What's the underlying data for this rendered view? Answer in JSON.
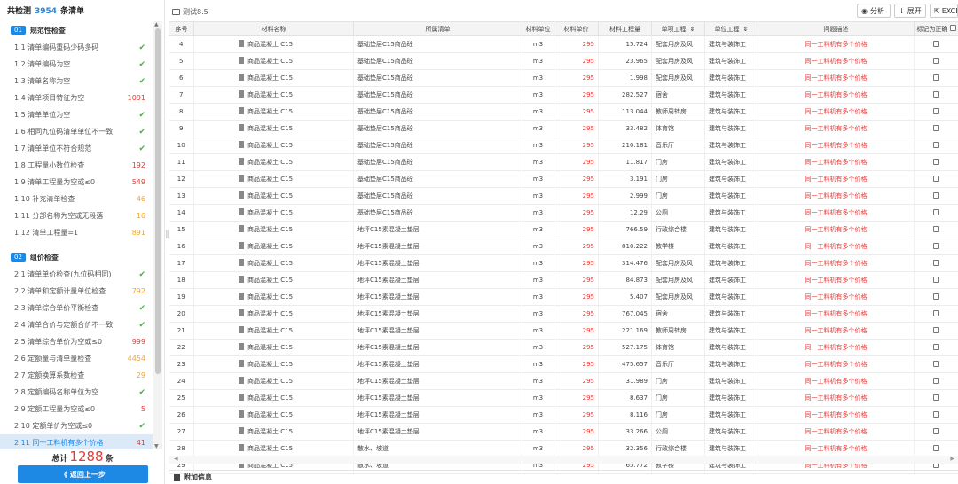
{
  "left": {
    "header_prefix": "共检测",
    "header_count": "3954",
    "header_suffix": "条清单",
    "groups": [
      {
        "badge": "01",
        "title": "规范性检查",
        "items": [
          {
            "label": "1.1 清单编码重码少码多码",
            "value": "✔",
            "kind": "green"
          },
          {
            "label": "1.2 清单编码为空",
            "value": "✔",
            "kind": "green"
          },
          {
            "label": "1.3 清单名称为空",
            "value": "✔",
            "kind": "green"
          },
          {
            "label": "1.4 清单项目特征为空",
            "value": "1091",
            "kind": "red"
          },
          {
            "label": "1.5 清单单位为空",
            "value": "✔",
            "kind": "green"
          },
          {
            "label": "1.6 相同九位码清单单位不一致",
            "value": "✔",
            "kind": "green"
          },
          {
            "label": "1.7 清单单位不符合规范",
            "value": "✔",
            "kind": "green"
          },
          {
            "label": "1.8 工程量小数位检查",
            "value": "192",
            "kind": "red"
          },
          {
            "label": "1.9 清单工程量为空或≤0",
            "value": "549",
            "kind": "red"
          },
          {
            "label": "1.10 补充清单检查",
            "value": "46",
            "kind": "orange"
          },
          {
            "label": "1.11 分部名称为空或无段落",
            "value": "16",
            "kind": "orange"
          },
          {
            "label": "1.12 清单工程量=1",
            "value": "891",
            "kind": "orange"
          }
        ]
      },
      {
        "badge": "02",
        "title": "组价检查",
        "items": [
          {
            "label": "2.1 清单单价检查(九位码相同)",
            "value": "✔",
            "kind": "green"
          },
          {
            "label": "2.2 清单和定额计量单位检查",
            "value": "792",
            "kind": "orange"
          },
          {
            "label": "2.3 清单综合单价平衡检查",
            "value": "✔",
            "kind": "green"
          },
          {
            "label": "2.4 清单合价与定额合价不一致",
            "value": "✔",
            "kind": "green"
          },
          {
            "label": "2.5 清单综合单价为空或≤0",
            "value": "999",
            "kind": "red"
          },
          {
            "label": "2.6 定额量与清单量检查",
            "value": "4454",
            "kind": "orange"
          },
          {
            "label": "2.7 定额换算系数检查",
            "value": "29",
            "kind": "orange"
          },
          {
            "label": "2.8 定额编码名称单位为空",
            "value": "✔",
            "kind": "green"
          },
          {
            "label": "2.9 定额工程量为空或≤0",
            "value": "5",
            "kind": "red"
          },
          {
            "label": "2.10 定额单价为空或≤0",
            "value": "✔",
            "kind": "green"
          },
          {
            "label": "2.11 同一工料机有多个价格",
            "value": "41",
            "kind": "red",
            "active": true
          },
          {
            "label": "2.12 工料机用量为空或≤0",
            "value": "5",
            "kind": "red"
          }
        ]
      }
    ],
    "total_label": "总计",
    "total_value": "1288",
    "total_unit": "条",
    "back_label": "《 返回上一步"
  },
  "right": {
    "breadcrumb": "测试8.5",
    "buttons": {
      "analyze": "分析",
      "expand": "展开",
      "export": "EXCE"
    },
    "columns": [
      "序号",
      "材料名称",
      "所属清单",
      "材料单位",
      "材料单价",
      "材料工程量",
      "单项工程",
      "单位工程",
      "问题描述",
      "标记为正确"
    ],
    "rows": [
      [
        "4",
        "商品混凝土 C15",
        "基础垫层C15商品砼",
        "m3",
        "295",
        "15.724",
        "配套用房及风",
        "建筑与装饰工",
        "同一工料机有多个价格"
      ],
      [
        "5",
        "商品混凝土 C15",
        "基础垫层C15商品砼",
        "m3",
        "295",
        "23.965",
        "配套用房及风",
        "建筑与装饰工",
        "同一工料机有多个价格"
      ],
      [
        "6",
        "商品混凝土 C15",
        "基础垫层C15商品砼",
        "m3",
        "295",
        "1.998",
        "配套用房及风",
        "建筑与装饰工",
        "同一工料机有多个价格"
      ],
      [
        "7",
        "商品混凝土 C15",
        "基础垫层C15商品砼",
        "m3",
        "295",
        "282.527",
        "宿舍",
        "建筑与装饰工",
        "同一工料机有多个价格"
      ],
      [
        "8",
        "商品混凝土 C15",
        "基础垫层C15商品砼",
        "m3",
        "295",
        "113.044",
        "教师周转房",
        "建筑与装饰工",
        "同一工料机有多个价格"
      ],
      [
        "9",
        "商品混凝土 C15",
        "基础垫层C15商品砼",
        "m3",
        "295",
        "33.482",
        "体育馆",
        "建筑与装饰工",
        "同一工料机有多个价格"
      ],
      [
        "10",
        "商品混凝土 C15",
        "基础垫层C15商品砼",
        "m3",
        "295",
        "210.181",
        "音乐厅",
        "建筑与装饰工",
        "同一工料机有多个价格"
      ],
      [
        "11",
        "商品混凝土 C15",
        "基础垫层C15商品砼",
        "m3",
        "295",
        "11.817",
        "门房",
        "建筑与装饰工",
        "同一工料机有多个价格"
      ],
      [
        "12",
        "商品混凝土 C15",
        "基础垫层C15商品砼",
        "m3",
        "295",
        "3.191",
        "门房",
        "建筑与装饰工",
        "同一工料机有多个价格"
      ],
      [
        "13",
        "商品混凝土 C15",
        "基础垫层C15商品砼",
        "m3",
        "295",
        "2.999",
        "门房",
        "建筑与装饰工",
        "同一工料机有多个价格"
      ],
      [
        "14",
        "商品混凝土 C15",
        "基础垫层C15商品砼",
        "m3",
        "295",
        "12.29",
        "公厕",
        "建筑与装饰工",
        "同一工料机有多个价格"
      ],
      [
        "15",
        "商品混凝土 C15",
        "地坪C15素混凝土垫层",
        "m3",
        "295",
        "766.59",
        "行政综合楼",
        "建筑与装饰工",
        "同一工料机有多个价格"
      ],
      [
        "16",
        "商品混凝土 C15",
        "地坪C15素混凝土垫层",
        "m3",
        "295",
        "810.222",
        "教学楼",
        "建筑与装饰工",
        "同一工料机有多个价格"
      ],
      [
        "17",
        "商品混凝土 C15",
        "地坪C15素混凝土垫层",
        "m3",
        "295",
        "314.476",
        "配套用房及风",
        "建筑与装饰工",
        "同一工料机有多个价格"
      ],
      [
        "18",
        "商品混凝土 C15",
        "地坪C15素混凝土垫层",
        "m3",
        "295",
        "84.873",
        "配套用房及风",
        "建筑与装饰工",
        "同一工料机有多个价格"
      ],
      [
        "19",
        "商品混凝土 C15",
        "地坪C15素混凝土垫层",
        "m3",
        "295",
        "5.407",
        "配套用房及风",
        "建筑与装饰工",
        "同一工料机有多个价格"
      ],
      [
        "20",
        "商品混凝土 C15",
        "地坪C15素混凝土垫层",
        "m3",
        "295",
        "767.045",
        "宿舍",
        "建筑与装饰工",
        "同一工料机有多个价格"
      ],
      [
        "21",
        "商品混凝土 C15",
        "地坪C15素混凝土垫层",
        "m3",
        "295",
        "221.169",
        "教师周转房",
        "建筑与装饰工",
        "同一工料机有多个价格"
      ],
      [
        "22",
        "商品混凝土 C15",
        "地坪C15素混凝土垫层",
        "m3",
        "295",
        "527.175",
        "体育馆",
        "建筑与装饰工",
        "同一工料机有多个价格"
      ],
      [
        "23",
        "商品混凝土 C15",
        "地坪C15素混凝土垫层",
        "m3",
        "295",
        "475.657",
        "音乐厅",
        "建筑与装饰工",
        "同一工料机有多个价格"
      ],
      [
        "24",
        "商品混凝土 C15",
        "地坪C15素混凝土垫层",
        "m3",
        "295",
        "31.989",
        "门房",
        "建筑与装饰工",
        "同一工料机有多个价格"
      ],
      [
        "25",
        "商品混凝土 C15",
        "地坪C15素混凝土垫层",
        "m3",
        "295",
        "8.637",
        "门房",
        "建筑与装饰工",
        "同一工料机有多个价格"
      ],
      [
        "26",
        "商品混凝土 C15",
        "地坪C15素混凝土垫层",
        "m3",
        "295",
        "8.116",
        "门房",
        "建筑与装饰工",
        "同一工料机有多个价格"
      ],
      [
        "27",
        "商品混凝土 C15",
        "地坪C15素混凝土垫层",
        "m3",
        "295",
        "33.266",
        "公厕",
        "建筑与装饰工",
        "同一工料机有多个价格"
      ],
      [
        "28",
        "商品混凝土 C15",
        "散水、坡道",
        "m3",
        "295",
        "32.356",
        "行政综合楼",
        "建筑与装饰工",
        "同一工料机有多个价格"
      ],
      [
        "29",
        "商品混凝土 C15",
        "散水、坡道",
        "m3",
        "295",
        "65.772",
        "教学楼",
        "建筑与装饰工",
        "同一工料机有多个价格"
      ]
    ],
    "footer": "附加信息"
  }
}
